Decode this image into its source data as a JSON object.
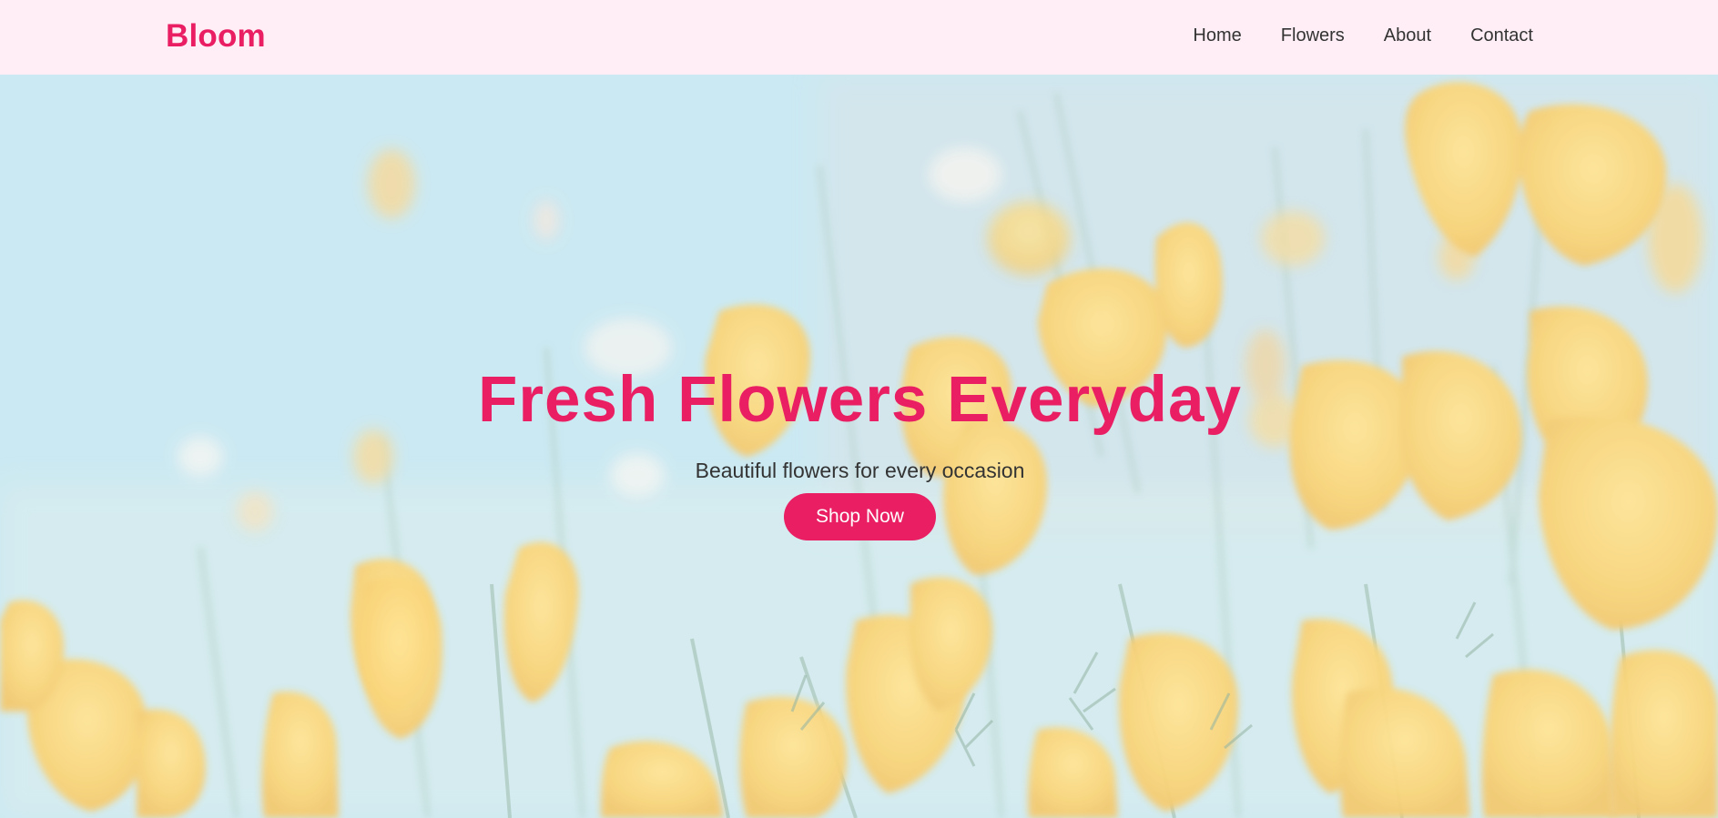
{
  "brand": {
    "name": "Bloom",
    "color": "#e91e63"
  },
  "nav": {
    "items": [
      {
        "label": "Home"
      },
      {
        "label": "Flowers"
      },
      {
        "label": "About"
      },
      {
        "label": "Contact"
      }
    ],
    "background": "#ffeef5",
    "text_color": "#333333"
  },
  "hero": {
    "title": "Fresh Flowers Everyday",
    "subtitle": "Beautiful flowers for every occasion",
    "cta_label": "Shop Now",
    "accent": "#e91e63",
    "background_image": "field of yellow poppy flowers against a light blue sky"
  }
}
